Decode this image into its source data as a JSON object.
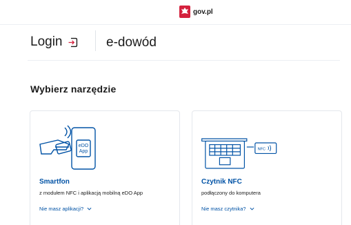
{
  "topbar": {
    "brand": "gov.pl"
  },
  "header": {
    "login": "Login",
    "service": "e-dowód"
  },
  "main": {
    "section_title": "Wybierz narzędzie",
    "cards": [
      {
        "title": "Smartfon",
        "subtitle": "z modułem NFC i aplikacją mobilną eDO App",
        "link": "Nie masz aplikacji?",
        "illustration_text": "eDO App"
      },
      {
        "title": "Czytnik NFC",
        "subtitle": "podłączony do komputera",
        "link": "Nie masz czytnika?",
        "illustration_text": "NFC"
      }
    ]
  },
  "colors": {
    "link_blue": "#0052a5",
    "border": "#e4e7ec",
    "brand_red": "#d4213d"
  }
}
